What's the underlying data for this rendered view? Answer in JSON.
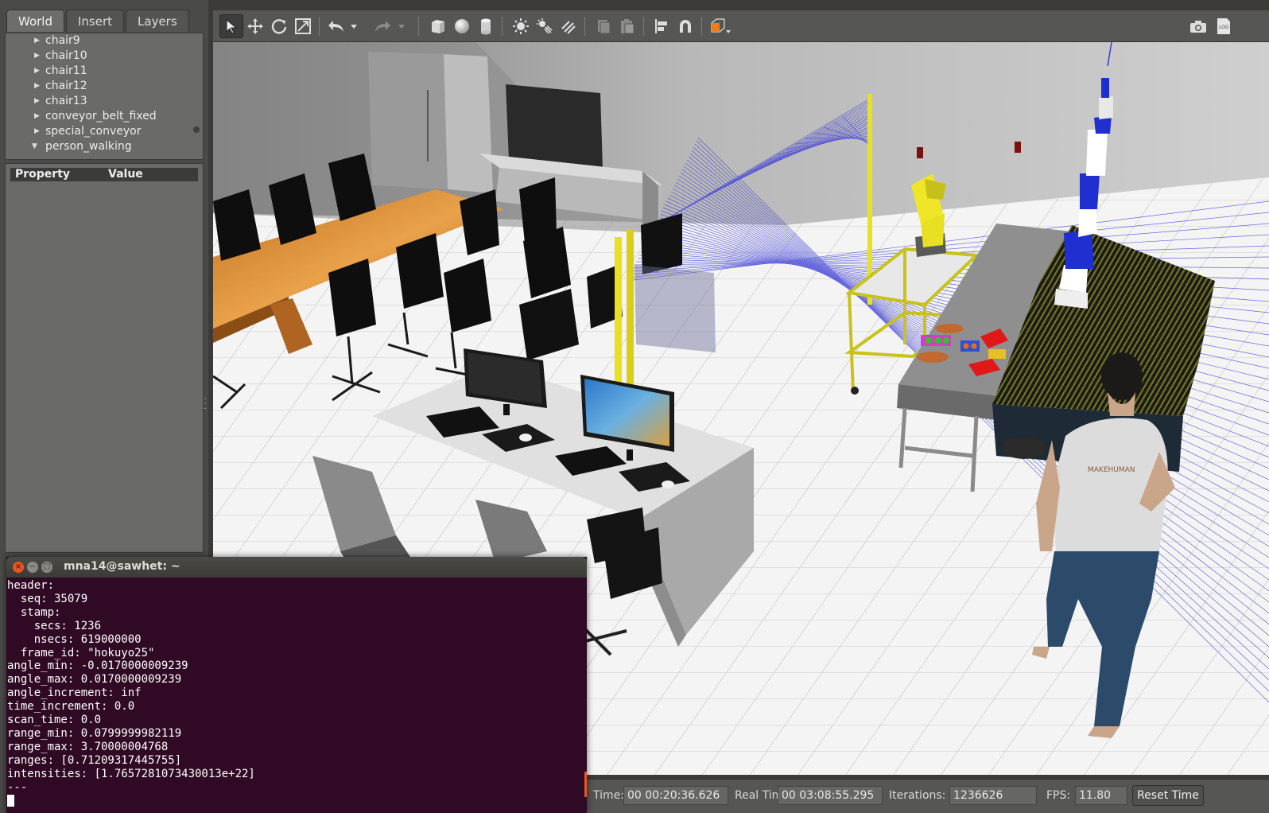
{
  "left_panel": {
    "tabs": [
      {
        "label": "World",
        "active": true
      },
      {
        "label": "Insert",
        "active": false
      },
      {
        "label": "Layers",
        "active": false
      }
    ],
    "model_list": [
      {
        "label": "chair9",
        "expanded": false
      },
      {
        "label": "chair10",
        "expanded": false
      },
      {
        "label": "chair11",
        "expanded": false
      },
      {
        "label": "chair12",
        "expanded": false
      },
      {
        "label": "chair13",
        "expanded": false
      },
      {
        "label": "conveyor_belt_fixed",
        "expanded": false
      },
      {
        "label": "special_conveyor",
        "expanded": false
      },
      {
        "label": "person_walking",
        "expanded": true
      }
    ],
    "property_header": {
      "property": "Property",
      "value": "Value"
    }
  },
  "toolbar": {
    "tools": [
      {
        "icon": "select-arrow-icon",
        "selected": true
      },
      {
        "icon": "translate-icon"
      },
      {
        "icon": "rotate-icon"
      },
      {
        "icon": "scale-icon"
      },
      {
        "icon": "undo-icon"
      },
      {
        "icon": "undo-dropdown-icon"
      },
      {
        "icon": "redo-icon"
      },
      {
        "icon": "redo-dropdown-icon"
      },
      {
        "icon": "box-shape-icon"
      },
      {
        "icon": "sphere-shape-icon"
      },
      {
        "icon": "cylinder-shape-icon"
      },
      {
        "icon": "point-light-icon"
      },
      {
        "icon": "spot-light-icon"
      },
      {
        "icon": "directional-light-icon"
      },
      {
        "icon": "copy-icon"
      },
      {
        "icon": "paste-icon"
      },
      {
        "icon": "align-icon"
      },
      {
        "icon": "snap-magnet-icon"
      },
      {
        "icon": "view-angle-cube-icon"
      },
      {
        "icon": "screenshot-camera-icon"
      },
      {
        "icon": "log-icon"
      }
    ],
    "accent_color": "#f07c1a"
  },
  "statusbar": {
    "sim_time_label": "Time:",
    "sim_time": "00 00:20:36.626",
    "real_time_label": "Real Time:",
    "real_time": "00 03:08:55.295",
    "iterations_label": "Iterations:",
    "iterations": "1236626",
    "fps_label": "FPS:",
    "fps": "11.80",
    "reset_label": "Reset Time"
  },
  "terminal": {
    "title": "mna14@sawhet: ~",
    "lines": [
      "header:",
      "  seq: 35079",
      "  stamp:",
      "    secs: 1236",
      "    nsecs: 619000000",
      "  frame_id: \"hokuyo25\"",
      "angle_min: -0.0170000009239",
      "angle_max: 0.0170000009239",
      "angle_increment: inf",
      "time_increment: 0.0",
      "scan_time: 0.0",
      "range_min: 0.0799999982119",
      "range_max: 3.70000004768",
      "ranges: [0.71209317445755]",
      "intensities: [1.7657281073430013e+22]",
      "---"
    ],
    "colors": {
      "background": "#300a24",
      "text": "#ffffff",
      "close": "#e95420"
    }
  },
  "scene": {
    "monitor_screen_logo": "MAKEHUMAN",
    "colors": {
      "laser": "#3b3bd6",
      "yellow_robot": "#e8e022",
      "blue_robot": "#1f2fd0",
      "table_wood": "#d98b2e"
    }
  }
}
